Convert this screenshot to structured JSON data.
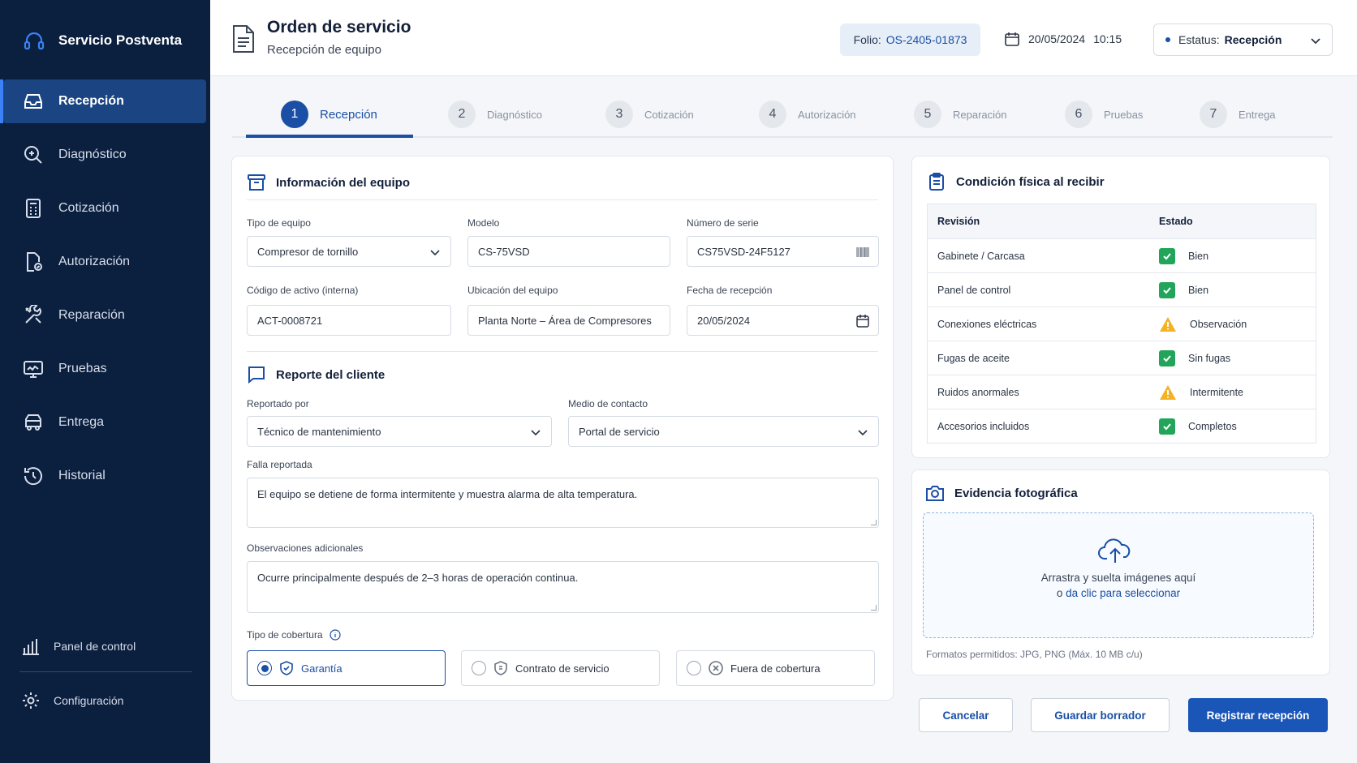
{
  "app": {
    "name": "Servicio Postventa"
  },
  "sidebar": {
    "items": [
      {
        "label": "Recepción",
        "icon": "inbox-icon",
        "active": true
      },
      {
        "label": "Diagnóstico",
        "icon": "magnifier-icon"
      },
      {
        "label": "Cotización",
        "icon": "calculator-doc-icon"
      },
      {
        "label": "Autorización",
        "icon": "doc-check-icon"
      },
      {
        "label": "Reparación",
        "icon": "tools-icon"
      },
      {
        "label": "Pruebas",
        "icon": "monitor-test-icon"
      },
      {
        "label": "Entrega",
        "icon": "truck-icon"
      },
      {
        "label": "Historial",
        "icon": "history-icon"
      }
    ],
    "bottom": [
      {
        "label": "Panel de control",
        "icon": "bar-chart-icon"
      },
      {
        "label": "Configuración",
        "icon": "gear-icon"
      }
    ]
  },
  "header": {
    "title": "Orden de servicio",
    "subtitle": "Recepción de equipo",
    "folio_label": "Folio:",
    "folio_value": "OS-2405-01873",
    "date": "20/05/2024",
    "time": "10:15",
    "status_label": "Estatus:",
    "status_value": "Recepción"
  },
  "stepper": {
    "steps": [
      {
        "num": "1",
        "label": "Recepción",
        "active": true
      },
      {
        "num": "2",
        "label": "Diagnóstico"
      },
      {
        "num": "3",
        "label": "Cotización"
      },
      {
        "num": "4",
        "label": "Autorización"
      },
      {
        "num": "5",
        "label": "Reparación"
      },
      {
        "num": "6",
        "label": "Pruebas"
      },
      {
        "num": "7",
        "label": "Entrega"
      }
    ]
  },
  "equipo": {
    "title": "Información del equipo",
    "tipo_label": "Tipo de equipo",
    "tipo_value": "Compresor de tornillo",
    "modelo_label": "Modelo",
    "modelo_value": "CS-75VSD",
    "serie_label": "Número de serie",
    "serie_value": "CS75VSD-24F5127",
    "activo_label": "Código de activo (interna)",
    "activo_value": "ACT-0008721",
    "ubicacion_label": "Ubicación del equipo",
    "ubicacion_value": "Planta Norte – Área de Compresores",
    "fecha_label": "Fecha de recepción",
    "fecha_value": "20/05/2024"
  },
  "reporte": {
    "title": "Reporte del cliente",
    "reportado_label": "Reportado por",
    "reportado_value": "Técnico de mantenimiento",
    "medio_label": "Medio de contacto",
    "medio_value": "Portal de servicio",
    "falla_label": "Falla reportada",
    "falla_value": "El equipo se detiene de forma intermitente y muestra alarma de alta temperatura.",
    "obs_label": "Observaciones adicionales",
    "obs_value": "Ocurre principalmente después de 2–3 horas de operación continua.",
    "cobertura_label": "Tipo de cobertura",
    "cobertura_options": [
      {
        "label": "Garantía",
        "selected": true
      },
      {
        "label": "Contrato de servicio"
      },
      {
        "label": "Fuera de cobertura"
      }
    ]
  },
  "condicion": {
    "title": "Condición física al recibir",
    "col1": "Revisión",
    "col2": "Estado",
    "rows": [
      {
        "item": "Gabinete / Carcasa",
        "estado": "Bien",
        "kind": "ok"
      },
      {
        "item": "Panel de control",
        "estado": "Bien",
        "kind": "ok"
      },
      {
        "item": "Conexiones eléctricas",
        "estado": "Observación",
        "kind": "warn"
      },
      {
        "item": "Fugas de aceite",
        "estado": "Sin fugas",
        "kind": "ok"
      },
      {
        "item": "Ruidos anormales",
        "estado": "Intermitente",
        "kind": "warn"
      },
      {
        "item": "Accesorios incluidos",
        "estado": "Completos",
        "kind": "ok"
      }
    ]
  },
  "evidencia": {
    "title": "Evidencia fotográfica",
    "drop_text": "Arrastra y suelta imágenes aquí",
    "drop_or": "o",
    "drop_link": "da clic para seleccionar",
    "formats": "Formatos permitidos: JPG, PNG (Máx. 10 MB c/u)"
  },
  "actions": {
    "cancel": "Cancelar",
    "draft": "Guardar borrador",
    "submit": "Registrar recepción"
  },
  "colors": {
    "sidebar": "#0b1f3f",
    "accent": "#1a4fa5",
    "ok": "#22a55a",
    "warn": "#f5b324"
  }
}
